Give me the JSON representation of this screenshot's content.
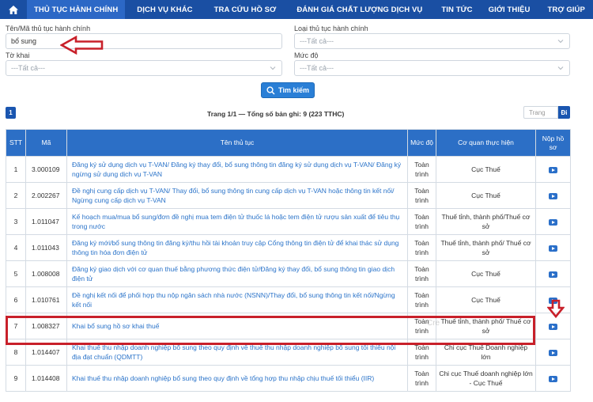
{
  "nav": {
    "items": [
      {
        "label": "THỦ TỤC HÀNH CHÍNH",
        "active": true
      },
      {
        "label": "DỊCH VỤ KHÁC",
        "active": false
      },
      {
        "label": "TRA CỨU HỒ SƠ",
        "active": false
      },
      {
        "label": "ĐÁNH GIÁ CHẤT LƯỢNG DỊCH VỤ",
        "active": false
      },
      {
        "label": "TIN TỨC",
        "active": false
      },
      {
        "label": "GIỚI THIỆU",
        "active": false
      },
      {
        "label": "TRỢ GIÚP",
        "active": false
      }
    ]
  },
  "form": {
    "name_label": "Tên/Mã thủ tục hành chính",
    "name_value": "bổ sung",
    "type_label": "Loại thủ tục hành chính",
    "type_value": "---Tất cả---",
    "form_label": "Tờ khai",
    "form_value": "---Tất cả---",
    "level_label": "Mức độ",
    "level_value": "---Tất cả---",
    "search_label": "Tìm kiếm"
  },
  "pager": {
    "current": "1",
    "info": "Trang 1/1 — Tổng số bản ghi: 9 (223 TTHC)",
    "input_placeholder": "Trang",
    "go_label": "Đi"
  },
  "table": {
    "headers": {
      "stt": "STT",
      "ma": "Mã",
      "name": "Tên thủ tục",
      "level": "Mức độ",
      "org": "Cơ quan thực hiện",
      "submit": "Nộp hồ sơ"
    },
    "rows": [
      {
        "stt": "1",
        "ma": "3.000109",
        "name": "Đăng ký sử dụng dịch vụ T-VAN/ Đăng ký thay đổi, bổ sung thông tin đăng ký sử dụng dịch vụ T-VAN/ Đăng ký ngừng sử dụng dịch vụ T-VAN",
        "level": "Toàn trình",
        "org": "Cục Thuế"
      },
      {
        "stt": "2",
        "ma": "2.002267",
        "name": "Đề nghị cung cấp dịch vụ T-VAN/ Thay đổi, bổ sung thông tin cung cấp dịch vụ T-VAN hoặc thông tin kết nối/ Ngừng cung cấp dịch vụ T-VAN",
        "level": "Toàn trình",
        "org": "Cục Thuế"
      },
      {
        "stt": "3",
        "ma": "1.011047",
        "name": "Kế hoạch mua/mua bổ sung/đơn đề nghị mua tem điện tử thuốc lá hoặc tem điện tử rượu sản xuất để tiêu thụ trong nước",
        "level": "Toàn trình",
        "org": "Thuế tỉnh, thành phố/Thuế cơ sở"
      },
      {
        "stt": "4",
        "ma": "1.011043",
        "name": "Đăng ký mới/bổ sung thông tin đăng ký/thu hồi tài khoản truy cập Cổng thông tin điện tử để khai thác sử dụng thông tin hóa đơn điện tử",
        "level": "Toàn trình",
        "org": "Thuế tỉnh, thành phố/ Thuế cơ sở"
      },
      {
        "stt": "5",
        "ma": "1.008008",
        "name": "Đăng ký giao dịch với cơ quan thuế bằng phương thức điện tử/Đăng ký thay đổi, bổ sung thông tin giao dịch điện tử",
        "level": "Toàn trình",
        "org": "Cục Thuế"
      },
      {
        "stt": "6",
        "ma": "1.010761",
        "name": "Đề nghị kết nối để phối hợp thu nộp ngân sách nhà nước (NSNN)/Thay đổi, bổ sung thông tin kết nối/Ngừng kết nối",
        "level": "Toàn trình",
        "org": "Cục Thuế"
      },
      {
        "stt": "7",
        "ma": "1.008327",
        "name": "Khai bổ sung hồ sơ khai thuế",
        "level": "Toàn trình",
        "org": "Thuế tỉnh, thành phố/ Thuế cơ sở"
      },
      {
        "stt": "8",
        "ma": "1.014407",
        "name": "Khai thuế thu nhập doanh nghiệp bổ sung theo quy định về thuế thu nhập doanh nghiệp bổ sung tối thiểu nội địa đạt chuẩn (QDMTT)",
        "level": "Toàn trình",
        "org": "Chi cục Thuế Doanh nghiệp lớn"
      },
      {
        "stt": "9",
        "ma": "1.014408",
        "name": "Khai thuế thu nhập doanh nghiệp bổ sung theo quy định về tổng hợp thu nhập chịu thuế tối thiểu (IIR)",
        "level": "Toàn trình",
        "org": "Chi cục Thuế doanh nghiệp lớn - Cục Thuế"
      }
    ]
  },
  "annotation": {
    "watermark": "Cre"
  },
  "colors": {
    "nav_bg": "#1a4fa3",
    "header_bg": "#2c6fc6",
    "link": "#2a73c9",
    "annotation_red": "#c8202a"
  }
}
